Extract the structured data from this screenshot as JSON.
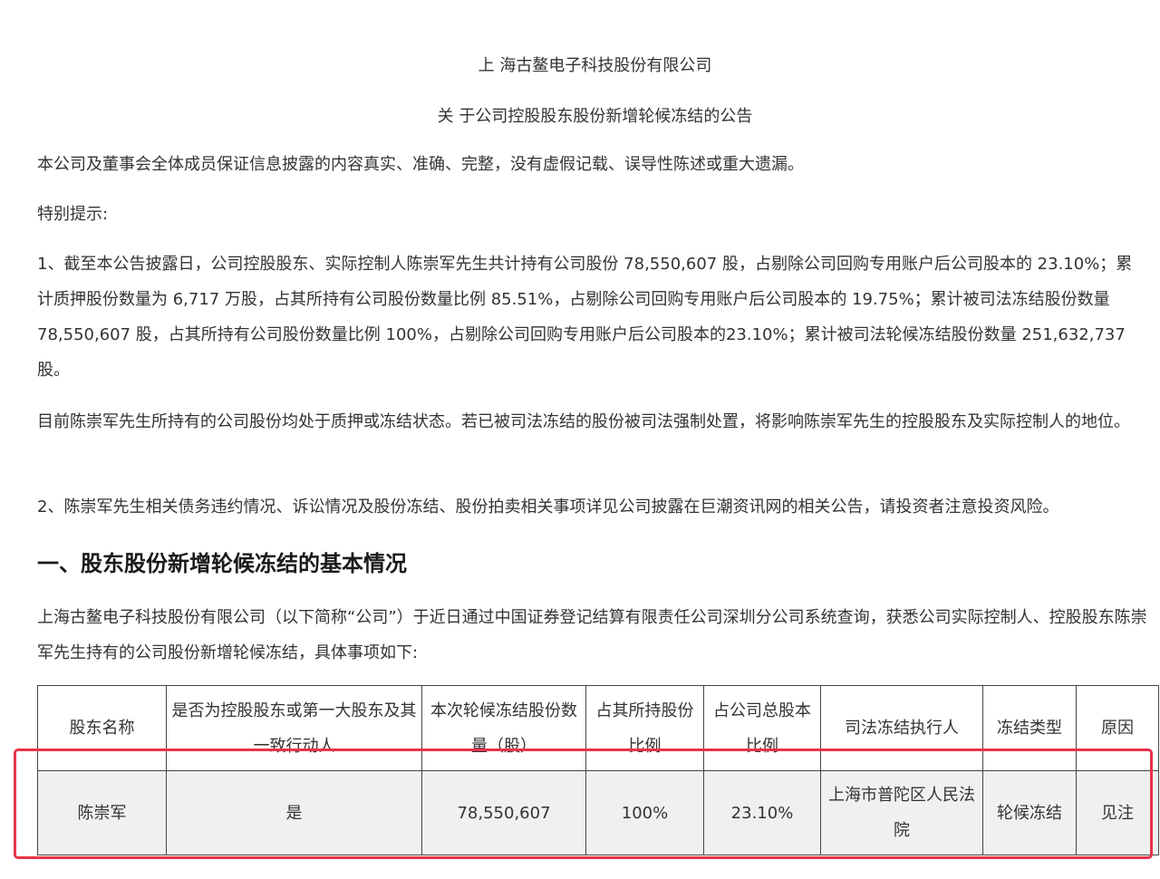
{
  "header": {
    "company": "上 海古鳌电子科技股份有限公司",
    "title": "关 于公司控股股东股份新增轮候冻结的公告"
  },
  "statement": "本公司及董事会全体成员保证信息披露的内容真实、准确、完整，没有虚假记载、误导性陈述或重大遗漏。",
  "tip_label": "特别提示:",
  "item1": "1、截至本公告披露日，公司控股股东、实际控制人陈崇军先生共计持有公司股份 78,550,607 股，占剔除公司回购专用账户后公司股本的 23.10%；累计质押股份数量为 6,717 万股，占其所持有公司股份数量比例 85.51%，占剔除公司回购专用账户后公司股本的 19.75%；累计被司法冻结股份数量 78,550,607 股，占其所持有公司股份数量比例 100%，占剔除公司回购专用账户后公司股本的23.10%；累计被司法轮候冻结股份数量 251,632,737 股。",
  "current_status": "目前陈崇军先生所持有的公司股份均处于质押或冻结状态。若已被司法冻结的股份被司法强制处置，将影响陈崇军先生的控股股东及实际控制人的地位。",
  "item2": "2、陈崇军先生相关债务违约情况、诉讼情况及股份冻结、股份拍卖相关事项详见公司披露在巨潮资讯网的相关公告，请投资者注意投资风险。",
  "section1_title": "一、股东股份新增轮候冻结的基本情况",
  "section1_intro": "上海古鳌电子科技股份有限公司（以下简称“公司”）于近日通过中国证券登记结算有限责任公司深圳分公司系统查询，获悉公司实际控制人、控股股东陈崇军先生持有的公司股份新增轮候冻结，具体事项如下:",
  "table": {
    "headers": [
      "股东名称",
      "是否为控股股东或第一大股东及其一致行动人",
      "本次轮候冻结股份数量（股）",
      "占其所持股份比例",
      "占公司总股本比例",
      "司法冻结执行人",
      "冻结类型",
      "原因"
    ],
    "row": [
      "陈崇军",
      "是",
      "78,550,607",
      "100%",
      "23.10%",
      "上海市普陀区人民法院",
      "轮候冻结",
      "见注"
    ]
  },
  "colors": {
    "highlight_box": "#e8334a",
    "row_background": "#f0f0f0"
  }
}
